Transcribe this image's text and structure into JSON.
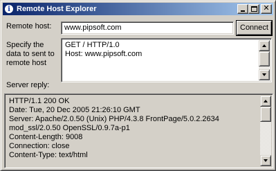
{
  "window": {
    "title": "Remote Host Explorer"
  },
  "host": {
    "label": "Remote host:",
    "value": "www.pipsoft.com",
    "connect_label": "Connect"
  },
  "request": {
    "label": "Specify the\ndata to sent to\nremote host",
    "text": "GET / HTTP/1.0\nHost: www.pipsoft.com"
  },
  "reply": {
    "label": "Server reply:",
    "text": "HTTP/1.1 200 OK\nDate: Tue, 20 Dec 2005 21:26:10 GMT\nServer: Apache/2.0.50 (Unix) PHP/4.3.8 FrontPage/5.0.2.2634\nmod_ssl/2.0.50 OpenSSL/0.9.7a-p1\nContent-Length: 9008\nConnection: close\nContent-Type: text/html"
  },
  "icons": {
    "title_icon": "info-icon",
    "minimize": "minimize-icon",
    "maximize": "maximize-icon",
    "close": "close-icon"
  }
}
